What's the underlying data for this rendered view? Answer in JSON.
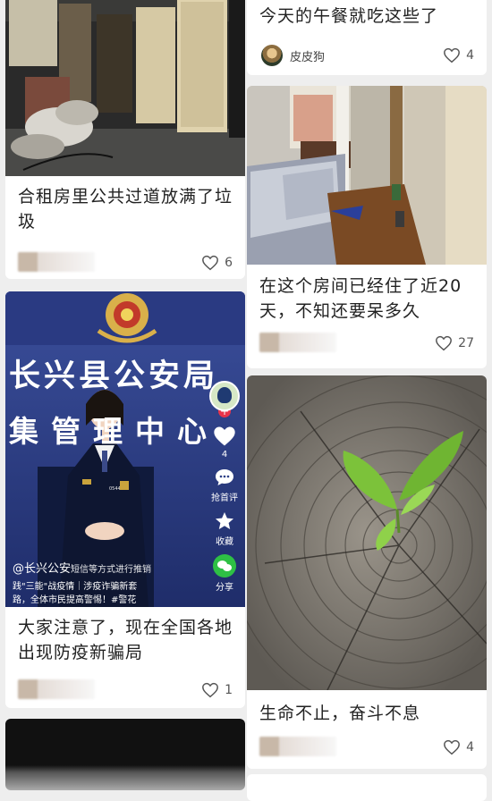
{
  "left_column": [
    {
      "title": "合租房里公共过道放满了垃圾",
      "likes": "6"
    },
    {
      "title": "大家注意了，现在全国各地出现防疫新骗局",
      "likes": "1",
      "video": {
        "sign_line1": "长兴县公安局",
        "sign_line2": "集管理中心",
        "badge_number": "054470",
        "caption_account": "@长兴公安",
        "caption_line1": "短信等方式进行推销",
        "caption_line2": "践\"三能\"战疫情｜涉疫诈骗新套",
        "caption_line3": "路，全体市民提高警惕！#警花",
        "like_count": "4",
        "comment_label": "抢首评",
        "favorite_label": "收藏",
        "share_label": "分享"
      }
    }
  ],
  "right_column": [
    {
      "title": "今天的午餐就吃这些了",
      "author": "皮皮狗",
      "likes": "4"
    },
    {
      "title": "在这个房间已经住了近20天，不知还要呆多久",
      "likes": "27"
    },
    {
      "title": "生命不止，奋斗不息",
      "likes": "4"
    }
  ],
  "colors": {
    "background": "#eeeeee",
    "card": "#ffffff",
    "title_text": "#222222",
    "police_blue": "#2d3f86",
    "badge_red": "#e8334a",
    "leaf_green": "#7cc23a"
  }
}
